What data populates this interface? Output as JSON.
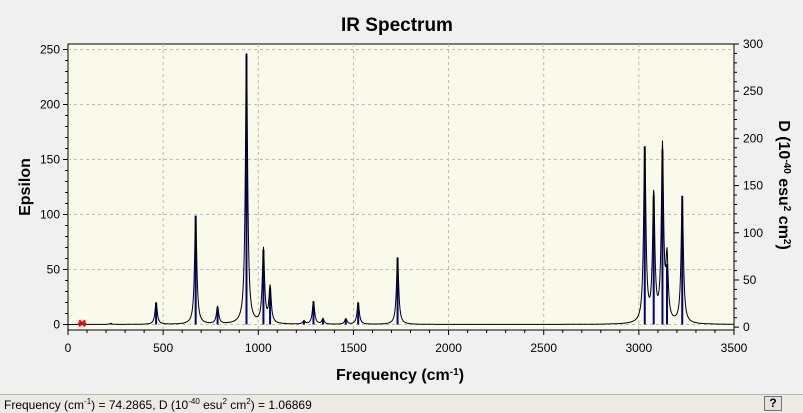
{
  "chart_data": {
    "type": "line",
    "title": "IR Spectrum",
    "xlabel": "Frequency (cm-1)",
    "ylabel": "Epsilon",
    "y2label": "D (10-40 esu2 cm2)",
    "xlim": [
      0,
      3500
    ],
    "ylim": [
      -5,
      255
    ],
    "y2lim": [
      -3,
      300
    ],
    "xticks": [
      0,
      500,
      1000,
      1500,
      2000,
      2500,
      3000,
      3500
    ],
    "yticks": [
      0,
      50,
      100,
      150,
      200,
      250
    ],
    "y2ticks": [
      0,
      50,
      100,
      150,
      200,
      250,
      300
    ],
    "grid": true,
    "curve_color": "#000000",
    "stick_color": "#000080",
    "marker_color": "#ff0000",
    "peak_width": 7,
    "peaks": [
      {
        "x": 225,
        "y": 1
      },
      {
        "x": 463,
        "y": 20
      },
      {
        "x": 671,
        "y": 99
      },
      {
        "x": 786,
        "y": 16
      },
      {
        "x": 938,
        "y": 246
      },
      {
        "x": 1027,
        "y": 68
      },
      {
        "x": 1062,
        "y": 33
      },
      {
        "x": 1240,
        "y": 3
      },
      {
        "x": 1290,
        "y": 21
      },
      {
        "x": 1340,
        "y": 5
      },
      {
        "x": 1460,
        "y": 5
      },
      {
        "x": 1525,
        "y": 20
      },
      {
        "x": 1732,
        "y": 61
      },
      {
        "x": 3031,
        "y": 162
      },
      {
        "x": 3078,
        "y": 117
      },
      {
        "x": 3124,
        "y": 159
      },
      {
        "x": 3148,
        "y": 55
      },
      {
        "x": 3228,
        "y": 117
      }
    ],
    "marker": {
      "x": 74.2865,
      "y": 1.06869
    }
  },
  "status": {
    "freq_label": "Frequency (cm",
    "freq_sup": "-1",
    "freq_value": ") = 74.2865, D (10",
    "d_sup1": "-40",
    "d_mid": " esu",
    "d_sup2": "2",
    "d_mid2": " cm",
    "d_sup3": "2",
    "d_value": ") = 1.06869"
  },
  "help_button": "?"
}
